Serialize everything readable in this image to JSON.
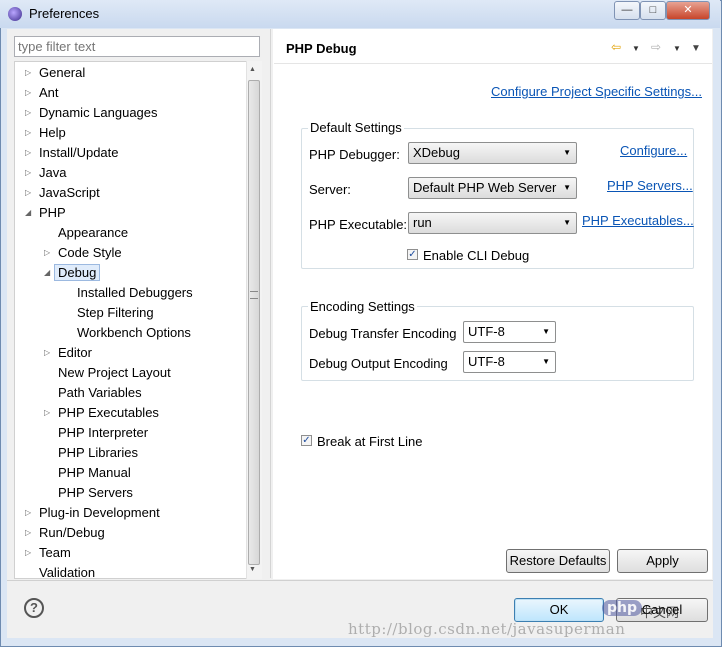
{
  "window": {
    "title": "Preferences"
  },
  "filter": {
    "placeholder": "type filter text"
  },
  "tree": {
    "items": [
      {
        "label": "General",
        "arrow": "▷"
      },
      {
        "label": "Ant",
        "arrow": "▷"
      },
      {
        "label": "Dynamic Languages",
        "arrow": "▷"
      },
      {
        "label": "Help",
        "arrow": "▷"
      },
      {
        "label": "Install/Update",
        "arrow": "▷"
      },
      {
        "label": "Java",
        "arrow": "▷"
      },
      {
        "label": "JavaScript",
        "arrow": "▷"
      },
      {
        "label": "PHP",
        "arrow": "◢"
      },
      {
        "label": "Appearance",
        "arrow": ""
      },
      {
        "label": "Code Style",
        "arrow": "▷"
      },
      {
        "label": "Debug",
        "arrow": "◢"
      },
      {
        "label": "Installed Debuggers",
        "arrow": ""
      },
      {
        "label": "Step Filtering",
        "arrow": ""
      },
      {
        "label": "Workbench Options",
        "arrow": ""
      },
      {
        "label": "Editor",
        "arrow": "▷"
      },
      {
        "label": "New Project Layout",
        "arrow": ""
      },
      {
        "label": "Path Variables",
        "arrow": ""
      },
      {
        "label": "PHP Executables",
        "arrow": "▷"
      },
      {
        "label": "PHP Interpreter",
        "arrow": ""
      },
      {
        "label": "PHP Libraries",
        "arrow": ""
      },
      {
        "label": "PHP Manual",
        "arrow": ""
      },
      {
        "label": "PHP Servers",
        "arrow": ""
      },
      {
        "label": "Plug-in Development",
        "arrow": "▷"
      },
      {
        "label": "Run/Debug",
        "arrow": "▷"
      },
      {
        "label": "Team",
        "arrow": "▷"
      },
      {
        "label": "Validation",
        "arrow": ""
      }
    ],
    "selected": "Debug"
  },
  "page": {
    "title": "PHP Debug",
    "configure_project_link": "Configure Project Specific Settings...",
    "default_settings": {
      "title": "Default Settings",
      "debugger_label": "PHP Debugger:",
      "debugger_value": "XDebug",
      "configure_link": "Configure...",
      "server_label": "Server:",
      "server_value": "Default PHP Web Server",
      "servers_link": "PHP Servers...",
      "executable_label": "PHP Executable:",
      "executable_value": "run",
      "executables_link": "PHP Executables...",
      "cli_debug_label": "Enable CLI Debug",
      "cli_debug_checked": true
    },
    "encoding_settings": {
      "title": "Encoding Settings",
      "transfer_label": "Debug Transfer Encoding",
      "transfer_value": "UTF-8",
      "output_label": "Debug Output Encoding",
      "output_value": "UTF-8"
    },
    "break_first_line_label": "Break at First Line",
    "break_first_line_checked": true,
    "restore_defaults_label": "Restore Defaults",
    "apply_label": "Apply"
  },
  "footer": {
    "ok_label": "OK",
    "cancel_label": "Cancel",
    "help_symbol": "?"
  },
  "watermark": {
    "url": "http://blog.csdn.net/javasuperman",
    "php_badge": "php",
    "zh_text": "中文网"
  },
  "colors": {
    "link": "#0a55b5",
    "selection": "#e0ecfb",
    "accent": "#3c7fb1"
  }
}
